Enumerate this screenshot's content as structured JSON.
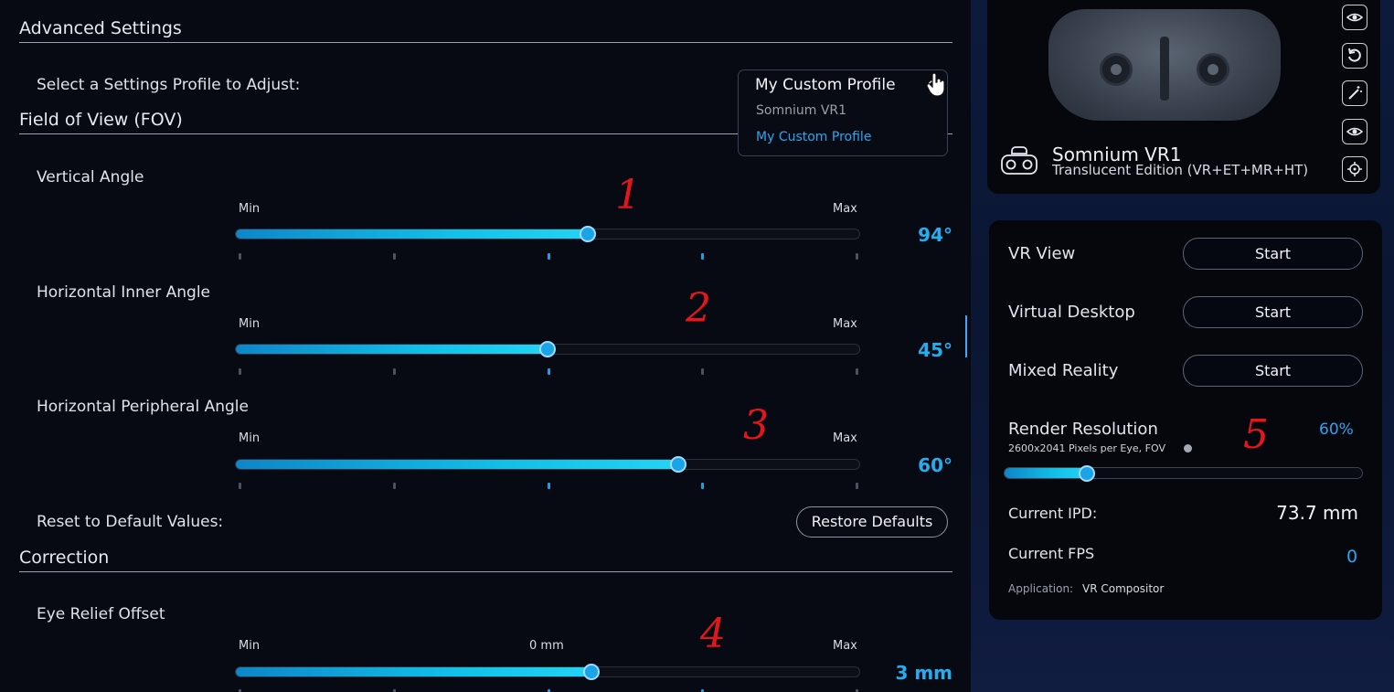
{
  "advanced_settings": {
    "title": "Advanced Settings",
    "profile_label": "Select a Settings Profile to Adjust:",
    "profile_dropdown": {
      "selected": "My Custom Profile",
      "options": [
        "Somnium VR1",
        "My Custom Profile"
      ]
    }
  },
  "fov": {
    "title": "Field of View (FOV)",
    "vertical": {
      "label": "Vertical Angle",
      "min": "Min",
      "max": "Max",
      "value": "94°",
      "position": 0.565
    },
    "horizontal_inner": {
      "label": "Horizontal Inner Angle",
      "min": "Min",
      "max": "Max",
      "value": "45°",
      "position": 0.5
    },
    "horizontal_peripheral": {
      "label": "Horizontal Peripheral Angle",
      "min": "Min",
      "max": "Max",
      "value": "60°",
      "position": 0.71
    },
    "reset_label": "Reset to Default Values:",
    "restore_button": "Restore Defaults"
  },
  "correction": {
    "title": "Correction",
    "eye_relief": {
      "label": "Eye Relief Offset",
      "min": "Min",
      "mid": "0 mm",
      "max": "Max",
      "value": "3 mm",
      "position": 0.57
    }
  },
  "annotations": [
    "1",
    "2",
    "3",
    "4",
    "5"
  ],
  "device": {
    "name": "Somnium VR1",
    "edition": "Translucent Edition (VR+ET+MR+HT)",
    "side_icons": [
      "eye-tracking-icon",
      "reset-icon",
      "magic-wand-icon",
      "eye-icon",
      "target-icon"
    ]
  },
  "controls": {
    "vr_view": {
      "label": "VR View",
      "button": "Start"
    },
    "virtual_desktop": {
      "label": "Virtual Desktop",
      "button": "Start"
    },
    "mixed_reality": {
      "label": "Mixed Reality",
      "button": "Start"
    },
    "render_resolution": {
      "label": "Render Resolution",
      "sub": "2600x2041 Pixels per Eye, FOV",
      "value": "60%",
      "position": 0.23
    },
    "ipd": {
      "label": "Current IPD:",
      "value": "73.7 mm"
    },
    "fps": {
      "label": "Current FPS",
      "value": "0"
    },
    "application": {
      "label": "Application:",
      "value": "VR Compositor"
    }
  },
  "colors": {
    "accent": "#24aef0",
    "annotation": "#e3151d",
    "background": "#070a12",
    "panel_bg": "#0c1a3c"
  }
}
